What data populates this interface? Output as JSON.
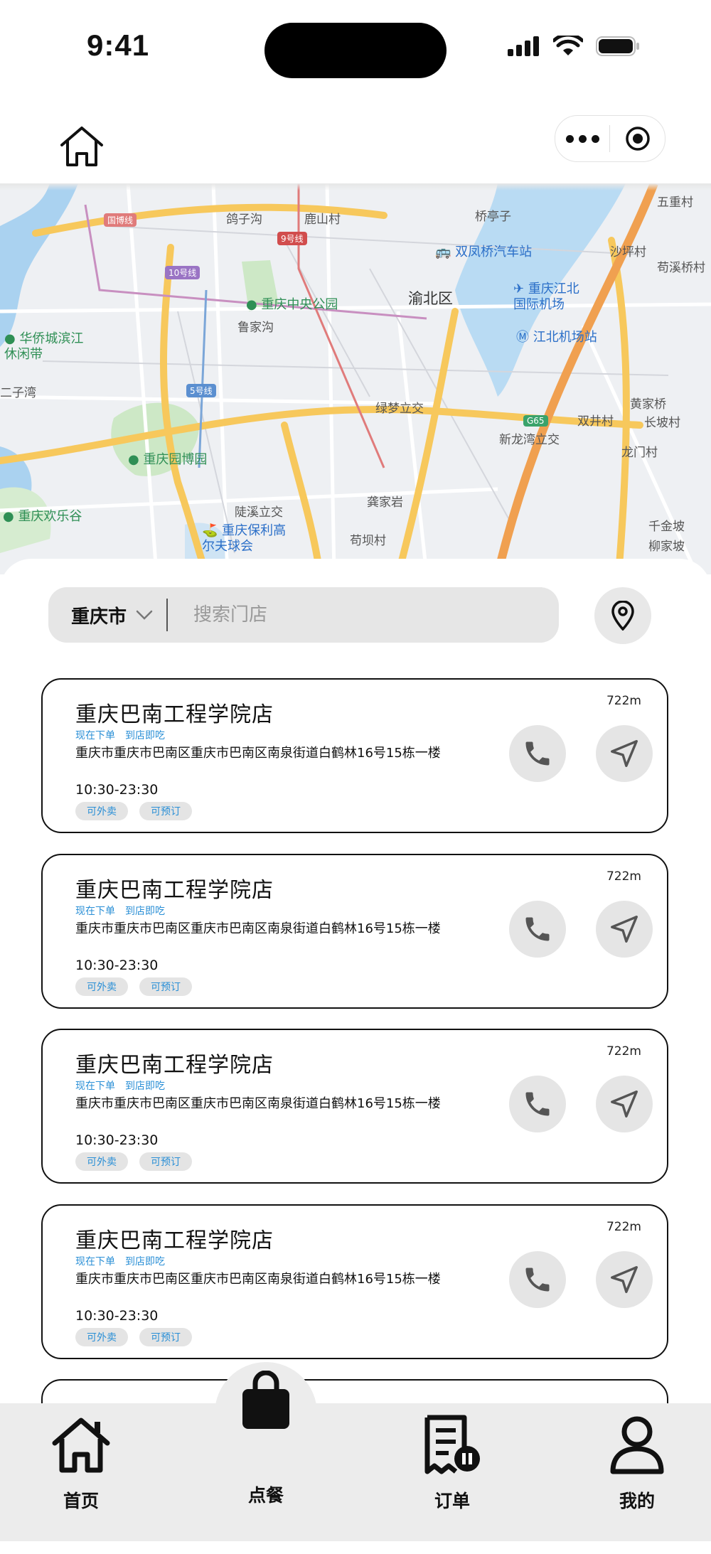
{
  "status_bar": {
    "time": "9:41"
  },
  "map": {
    "labels": {
      "yuzhong_district": "渝北区",
      "central_park": "重庆中央公园",
      "garden_expo": "重庆园博园",
      "shuangfengqiao_station": "双凤桥汽车站",
      "jiangbei_airport": "重庆江北国际机场",
      "airport_station": "江北机场站",
      "huaqiao_park": "华侨城滨江休闲带",
      "happy_valley": "重庆欢乐谷",
      "poly_golf": "重庆保利高尔夫球会",
      "gezigou": "鸽子沟",
      "lushancun": "鹿山村",
      "qiaotingzi": "桥亭子",
      "lujiagou": "鲁家沟",
      "lumeng_interchange": "绿梦立交",
      "xinlongwan_interchange": "新龙湾立交",
      "shuangjingcun": "双井村",
      "huangjiaqiao": "黄家桥",
      "changpocun": "长坡村",
      "longmencun": "龙门村",
      "qianjinpo": "千金坡",
      "liujiapo": "柳家坡",
      "gongjiayan": "龚家岩",
      "goubacun": "苟坝村",
      "lingxi_interchange": "陡溪立交",
      "wuzhongcun": "五重村",
      "shashaocun": "沙坪村",
      "goupixicun": "苟溪桥村",
      "erzhiwan": "二子湾",
      "line_guobo": "国博线",
      "line_9": "9号线",
      "line_10": "10号线",
      "line_5": "5号线",
      "g65": "G65"
    }
  },
  "search": {
    "city": "重庆市",
    "placeholder": "搜索门店"
  },
  "stores": [
    {
      "name": "重庆巴南工程学院店",
      "distance": "722m",
      "tag_now": "现在下单",
      "tag_eat": "到店即吃",
      "address": "重庆市重庆市巴南区重庆市巴南区南泉街道白鹤林16号15栋一楼",
      "hours": "10:30-23:30",
      "badge_delivery": "可外卖",
      "badge_reserve": "可预订"
    },
    {
      "name": "重庆巴南工程学院店",
      "distance": "722m",
      "tag_now": "现在下单",
      "tag_eat": "到店即吃",
      "address": "重庆市重庆市巴南区重庆市巴南区南泉街道白鹤林16号15栋一楼",
      "hours": "10:30-23:30",
      "badge_delivery": "可外卖",
      "badge_reserve": "可预订"
    },
    {
      "name": "重庆巴南工程学院店",
      "distance": "722m",
      "tag_now": "现在下单",
      "tag_eat": "到店即吃",
      "address": "重庆市重庆市巴南区重庆市巴南区南泉街道白鹤林16号15栋一楼",
      "hours": "10:30-23:30",
      "badge_delivery": "可外卖",
      "badge_reserve": "可预订"
    },
    {
      "name": "重庆巴南工程学院店",
      "distance": "722m",
      "tag_now": "现在下单",
      "tag_eat": "到店即吃",
      "address": "重庆市重庆市巴南区重庆市巴南区南泉街道白鹤林16号15栋一楼",
      "hours": "10:30-23:30",
      "badge_delivery": "可外卖",
      "badge_reserve": "可预订"
    }
  ],
  "tabbar": {
    "home": "首页",
    "order_food": "点餐",
    "orders": "订单",
    "mine": "我的"
  },
  "colors": {
    "accent_blue": "#2a8fd6",
    "map_road": "#f7c85c",
    "map_highway": "#f0a050",
    "map_water": "#aad2f0",
    "map_park": "#cde8c6"
  }
}
